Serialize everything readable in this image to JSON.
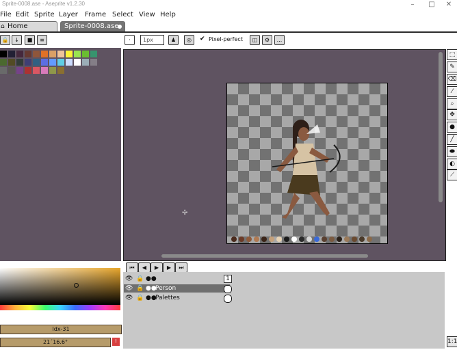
{
  "window": {
    "title": "Sprite-0008.ase - Aseprite v1.2.30",
    "minimize_glyph": "–",
    "maximize_glyph": "□",
    "close_glyph": "✕"
  },
  "menu": [
    "File",
    "Edit",
    "Sprite",
    "Layer",
    "Frame",
    "Select",
    "View",
    "Help"
  ],
  "tabs": [
    {
      "label": "Home",
      "icon": "home-icon"
    },
    {
      "label": "Sprite-0008.ase",
      "icon": "dot-icon"
    }
  ],
  "toolbar": {
    "brush_size": "1px",
    "pixel_perfect_label": "Pixel-perfect",
    "pixel_perfect_checked": true,
    "more_label": "..."
  },
  "palette_colors": [
    "#000000",
    "#222034",
    "#45283c",
    "#663931",
    "#8f563b",
    "#df7126",
    "#d9a066",
    "#eec39a",
    "#fbf236",
    "#99e550",
    "#6abe30",
    "#37946e",
    "#4b692f",
    "#524b24",
    "#323c39",
    "#3f3f74",
    "#306082",
    "#5b6ee1",
    "#639bff",
    "#5fcde4",
    "#cbdbfc",
    "#ffffff",
    "#9badb7",
    "#847e87",
    "#696a6a",
    "#595652",
    "#76428a",
    "#ac3232",
    "#d95763",
    "#d77bba",
    "#8f974a",
    "#8a6f30"
  ],
  "sprite_palette_strip": [
    "#4a2a1c",
    "#6b3a26",
    "#8e5a3a",
    "#b07a52",
    "#3b2418",
    "#c4a07a",
    "#e6d2b4",
    "#1a1a1a",
    "#ffffff",
    "#2a2a2a",
    "#d8d8d8",
    "#3a6ad8",
    "#5a4030",
    "#7a5a40",
    "#2a2018",
    "#9a7a5a",
    "#6a4a30",
    "#4a3a2a",
    "#8a6a4a"
  ],
  "timeline": {
    "frame_number": "1",
    "layers": [
      {
        "name": "Person",
        "visible": true,
        "locked": false,
        "selected": true
      },
      {
        "name": "Palettes",
        "visible": true,
        "locked": false,
        "selected": false
      }
    ]
  },
  "color": {
    "index_label": "Idx-31",
    "coords_label": "21´16.6°"
  },
  "zoom_button_label": "1:1"
}
